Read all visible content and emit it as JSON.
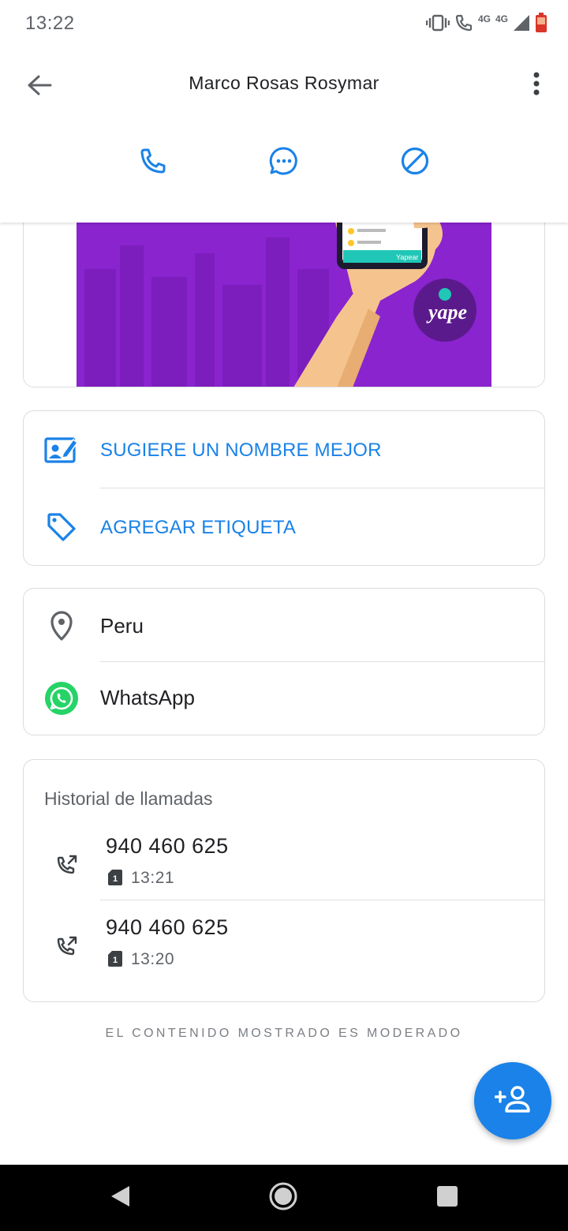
{
  "status_bar": {
    "time": "13:22",
    "network_label_1": "4G",
    "network_label_2": "4G",
    "icons": [
      "vibrate-icon",
      "wifi-call-icon",
      "signal-icon",
      "battery-icon"
    ]
  },
  "header": {
    "title": "Marco Rosas Rosymar",
    "back_icon": "arrow-back-icon",
    "more_icon": "more-vert-icon",
    "actions": [
      {
        "name": "call",
        "icon": "phone-icon"
      },
      {
        "name": "message",
        "icon": "chat-icon"
      },
      {
        "name": "block",
        "icon": "block-icon"
      }
    ]
  },
  "banner": {
    "brand_text": "yape",
    "phone_button": "Yapear"
  },
  "suggest_card": {
    "items": [
      {
        "label": "SUGIERE UN NOMBRE MEJOR",
        "icon": "edit-contact-icon"
      },
      {
        "label": "AGREGAR ETIQUETA",
        "icon": "tag-icon"
      }
    ]
  },
  "info_card": {
    "items": [
      {
        "label": "Peru",
        "icon": "location-pin-icon"
      },
      {
        "label": "WhatsApp",
        "icon": "whatsapp-icon"
      }
    ]
  },
  "call_history": {
    "title": "Historial de llamadas",
    "entries": [
      {
        "number": "940 460 625",
        "time": "13:21",
        "sim": "1",
        "icon": "outgoing-call-icon"
      },
      {
        "number": "940 460 625",
        "time": "13:20",
        "sim": "1",
        "icon": "outgoing-call-icon"
      }
    ]
  },
  "footer_note": "EL CONTENIDO MOSTRADO ES MODERADO",
  "fab": {
    "icon": "add-contact-icon"
  },
  "colors": {
    "accent": "#1a82e8",
    "banner_purple": "#8a24cf",
    "whatsapp_green": "#25d366",
    "battery_red": "#d9352a"
  }
}
